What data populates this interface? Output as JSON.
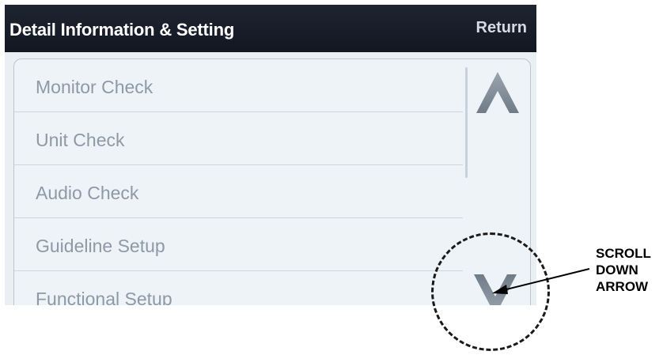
{
  "header": {
    "title": "Detail Information & Setting",
    "return_label": "Return"
  },
  "menu": {
    "items": [
      {
        "label": "Monitor Check"
      },
      {
        "label": "Unit Check"
      },
      {
        "label": "Audio Check"
      },
      {
        "label": "Guideline Setup"
      },
      {
        "label": "Functional Setup"
      }
    ]
  },
  "icons": {
    "scroll_up": "chevron-up-icon",
    "scroll_down": "chevron-down-icon"
  },
  "annotation": {
    "label_lines": [
      "SCROLL",
      "DOWN",
      "ARROW"
    ]
  },
  "colors": {
    "header_bg": "#161b27",
    "item_text": "#8d99a6",
    "arrow": "#7f8b97"
  }
}
